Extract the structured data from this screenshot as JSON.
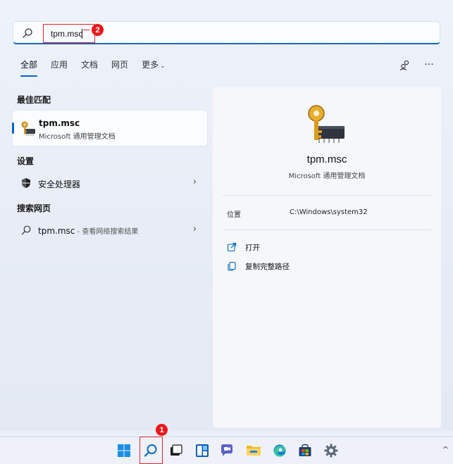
{
  "search": {
    "value": "tpm.msc",
    "callout_number": "2"
  },
  "tabs": [
    {
      "label": "全部",
      "active": true
    },
    {
      "label": "应用",
      "active": false
    },
    {
      "label": "文档",
      "active": false
    },
    {
      "label": "网页",
      "active": false
    },
    {
      "label": "更多",
      "active": false,
      "has_dropdown": true
    }
  ],
  "toolbar_icons": [
    "account-switch-icon",
    "more-options-icon"
  ],
  "more_glyph": "···",
  "sections": {
    "best_match": "最佳匹配",
    "settings": "设置",
    "web_search": "搜索网页"
  },
  "best_match": {
    "title": "tpm.msc",
    "subtitle": "Microsoft 通用管理文档",
    "icon": "key-chip-icon"
  },
  "settings_item": {
    "label": "安全处理器",
    "icon": "shield-icon",
    "arrow": "›"
  },
  "web_item": {
    "query": "tpm.msc",
    "suffix": " - 查看网络搜索结果",
    "icon": "search-icon",
    "arrow": "›"
  },
  "detail": {
    "title": "tpm.msc",
    "subtitle": "Microsoft 通用管理文档",
    "location_label": "位置",
    "location_value": "C:\\Windows\\system32",
    "actions": [
      {
        "label": "打开",
        "icon": "open-external-icon"
      },
      {
        "label": "复制完整路径",
        "icon": "copy-icon"
      }
    ]
  },
  "taskbar": {
    "callout_number": "1",
    "items": [
      "start-icon",
      "search-icon",
      "task-view-icon",
      "widgets-icon",
      "chat-icon",
      "file-explorer-icon",
      "edge-icon",
      "store-icon",
      "settings-icon"
    ],
    "tray_chevron": "^"
  },
  "colors": {
    "accent": "#0067c0",
    "callout_red": "#e8171c"
  }
}
